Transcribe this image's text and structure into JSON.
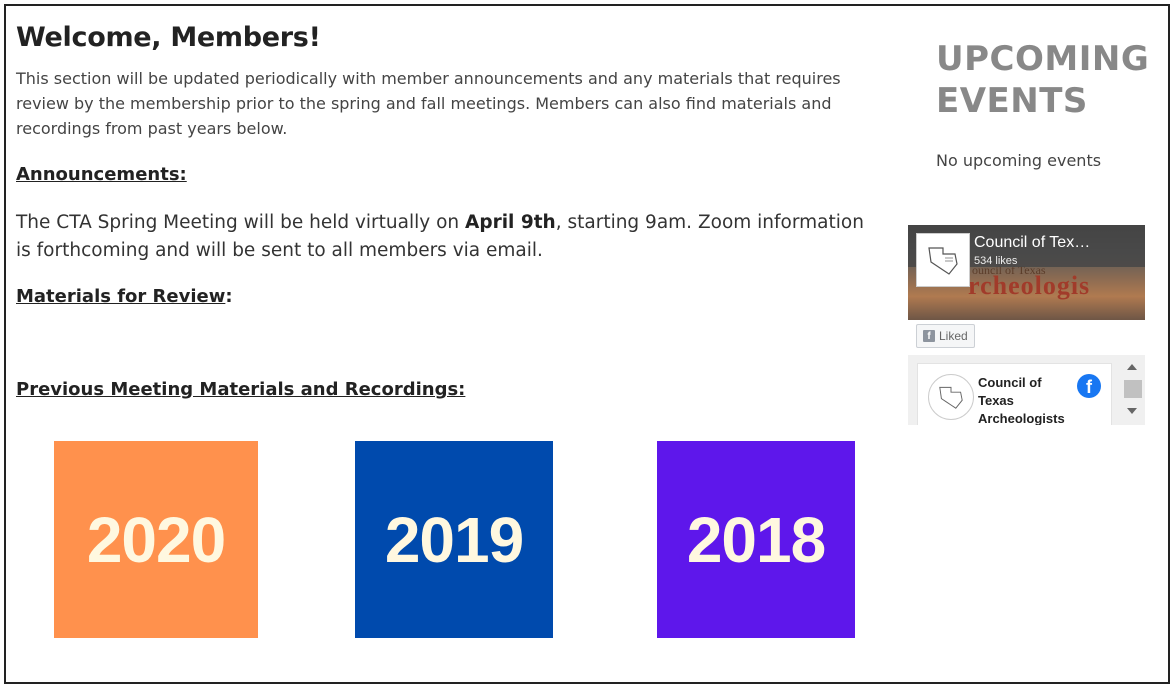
{
  "main": {
    "title": "Welcome, Members!",
    "intro": "This section will be updated periodically with member announcements and any materials that requires review by the membership prior to the spring and fall meetings. Members can also find materials and recordings from past years below.",
    "announcements_heading": "Announcements:",
    "announcement_pre": "The CTA Spring Meeting will be held virtually on ",
    "announcement_bold": "April 9th",
    "announcement_post": ", starting 9am. Zoom information is forthcoming and will be sent to all members via email.",
    "materials_heading": "Materials for Review",
    "materials_colon": ":",
    "previous_heading": "Previous Meeting Materials and Recordings:",
    "tiles": [
      {
        "label": "2020",
        "color": "#ff914d"
      },
      {
        "label": "2019",
        "color": "#004aad"
      },
      {
        "label": "2018",
        "color": "#5e17eb"
      }
    ]
  },
  "sidebar": {
    "events_title": "UPCOMING EVENTS",
    "no_events": "No upcoming events",
    "facebook": {
      "page_name": "Council of Tex…",
      "likes": "534 likes",
      "cover_sub": "ouncil of Texas",
      "cover_text": "rcheologis",
      "liked_label": "Liked",
      "feed_name": "Council of Texas Archeologists",
      "brand_color": "#1877f2"
    }
  }
}
